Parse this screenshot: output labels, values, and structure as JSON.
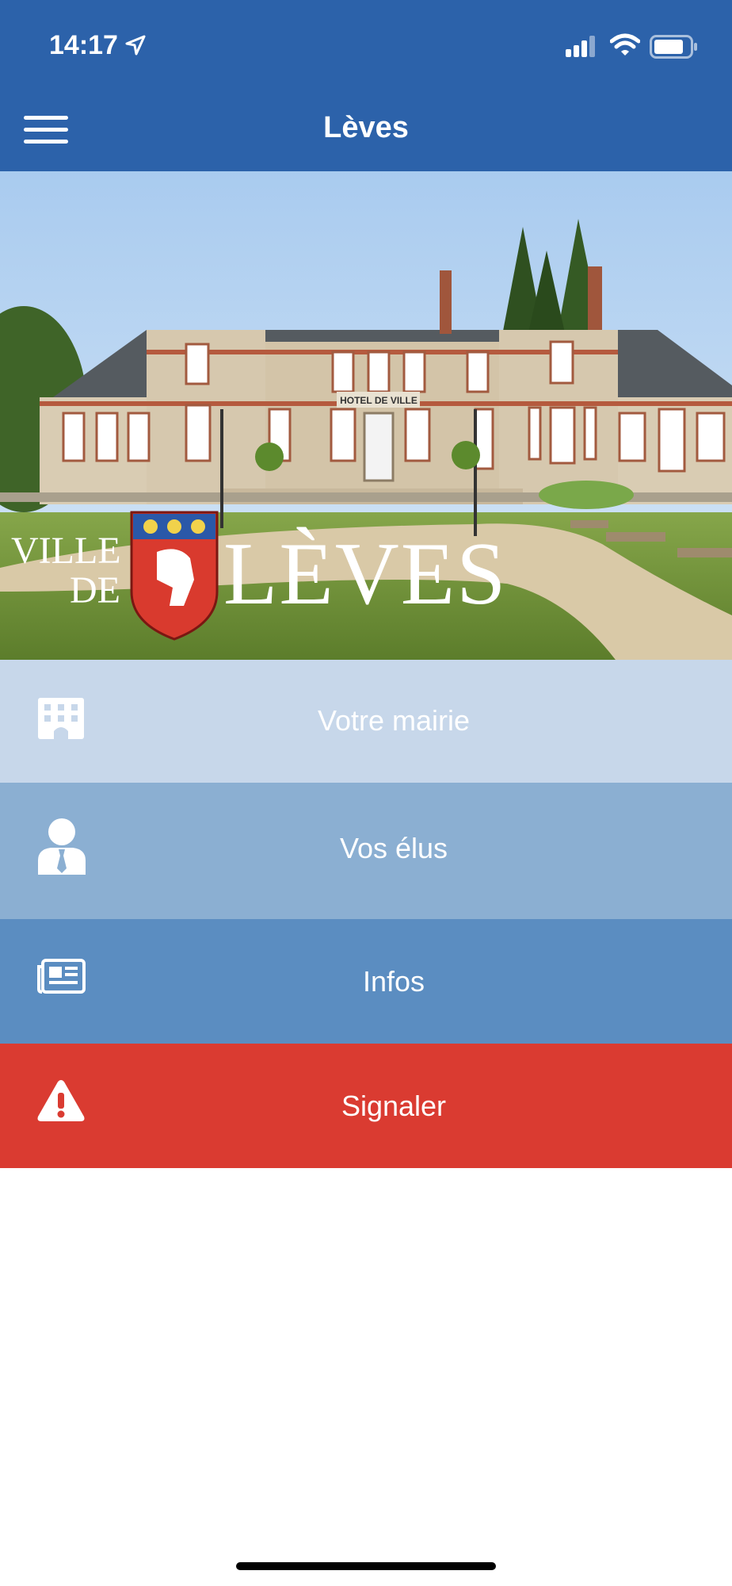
{
  "status_bar": {
    "time": "14:17"
  },
  "header": {
    "title": "Lèves"
  },
  "hero": {
    "brand_line1": "VILLE",
    "brand_line2": "DE",
    "brand_name": "LÈVES",
    "building_sign": "HOTEL DE VILLE"
  },
  "menu": {
    "votre_mairie": "Votre mairie",
    "vos_elus": "Vos élus",
    "infos": "Infos",
    "signaler": "Signaler"
  },
  "colors": {
    "header": "#2c62aa",
    "tile1": "#c7d7ea",
    "tile2": "#8bafd2",
    "tile3": "#5b8dc1",
    "tile4": "#da3b31"
  }
}
